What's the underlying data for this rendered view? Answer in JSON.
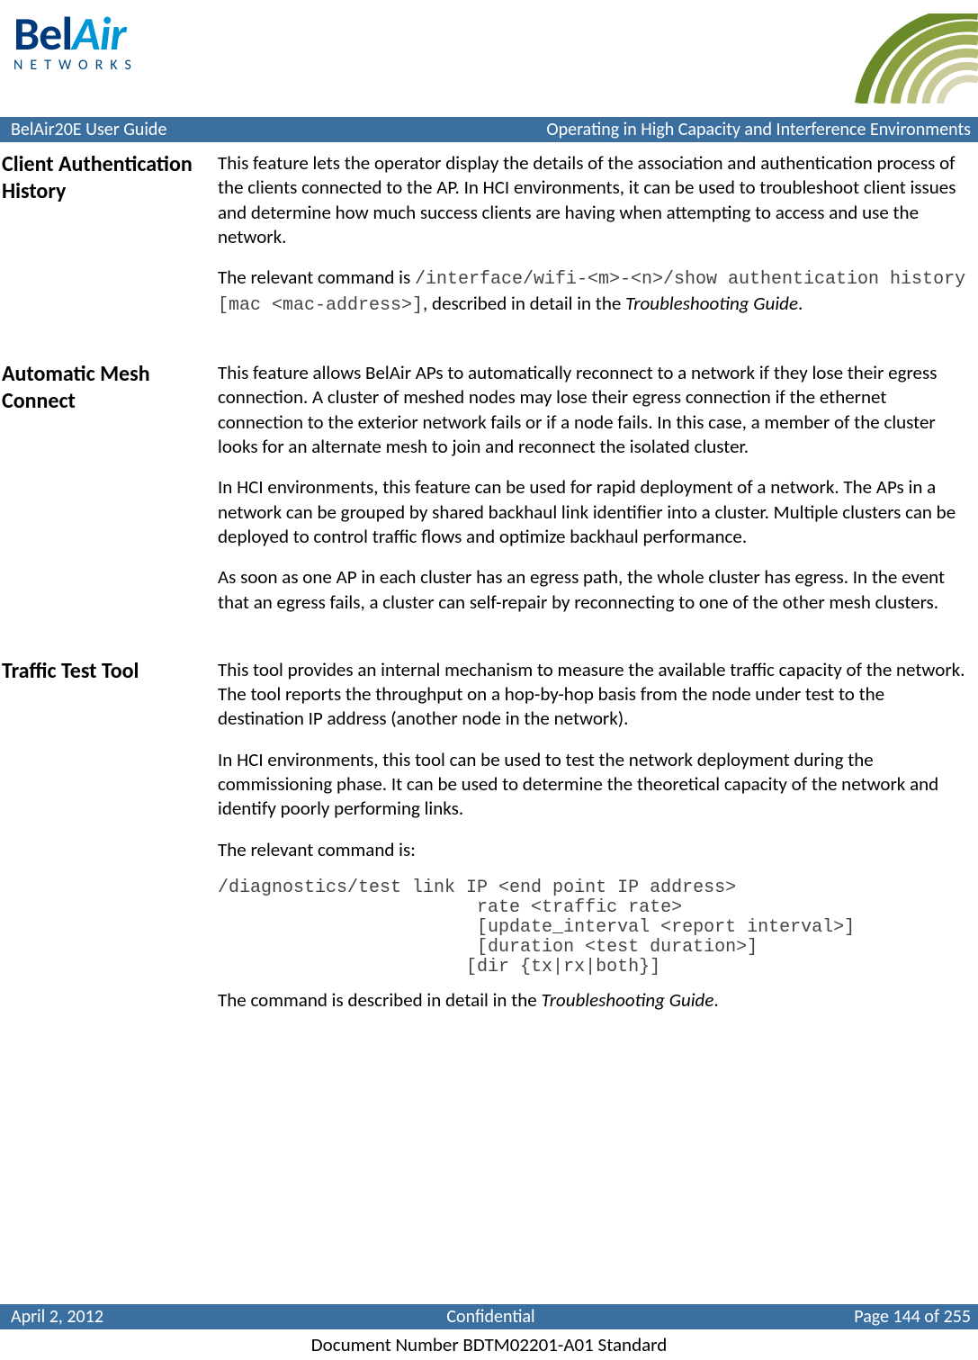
{
  "logo": {
    "line1a": "Bel",
    "line1b": "Air",
    "line2": "NETWORKS"
  },
  "banner": {
    "left": "BelAir20E User Guide",
    "right": "Operating in High Capacity and Interference Environments"
  },
  "sections": [
    {
      "heading": "Client Authentication History",
      "paras": [
        {
          "type": "text",
          "text": "This feature lets the operator display the details of the association and authentication process of the clients connected to the AP. In HCI environments, it can be used to troubleshoot client issues and determine how much success clients are having when attempting to access and use the network."
        },
        {
          "type": "mixed",
          "parts": [
            {
              "t": "The relevant command is "
            },
            {
              "t": "/interface/wifi-<m>-<n>/show authentication history [mac <mac-address>]",
              "code": true
            },
            {
              "t": ", described in detail in the "
            },
            {
              "t": "Troubleshooting Guide",
              "ital": true
            },
            {
              "t": "."
            }
          ]
        }
      ]
    },
    {
      "heading": "Automatic Mesh Connect",
      "paras": [
        {
          "type": "text",
          "text": "This feature allows BelAir APs to automatically reconnect to a network if they lose their egress connection. A cluster of meshed nodes may lose their egress connection if the ethernet connection to the exterior network fails or if a node fails. In this case, a member of the cluster looks for an alternate mesh to join and reconnect the isolated cluster."
        },
        {
          "type": "text",
          "text": "In HCI environments, this feature can be used for rapid deployment of a network. The APs in a network can be grouped by shared backhaul link identifier into a cluster. Multiple clusters can be deployed to control traffic flows and optimize backhaul performance."
        },
        {
          "type": "text",
          "text": "As soon as one AP in each cluster has an egress path, the whole cluster has egress. In the event that an egress fails, a cluster can self-repair by reconnecting to one of the other mesh clusters."
        }
      ]
    },
    {
      "heading": "Traffic Test Tool",
      "paras": [
        {
          "type": "text",
          "text": "This tool provides an internal mechanism to measure the available traffic capacity of the network. The tool reports the throughput on a hop-by-hop basis from the node under test to the destination IP address (another node in the network)."
        },
        {
          "type": "text",
          "text": "In HCI environments, this tool can be used to test the network deployment during the commissioning phase. It can be used to determine the theoretical capacity of the network and identify poorly performing links."
        },
        {
          "type": "text",
          "text": "The relevant command is:"
        },
        {
          "type": "codeblock",
          "text": "/diagnostics/test link IP <end point IP address>\n                        rate <traffic rate>\n                        [update_interval <report interval>]\n                        [duration <test duration>]\n                       [dir {tx|rx|both}]"
        },
        {
          "type": "mixed",
          "parts": [
            {
              "t": "The command is described in detail in the "
            },
            {
              "t": "Troubleshooting Guide",
              "ital": true
            },
            {
              "t": "."
            }
          ]
        }
      ]
    }
  ],
  "footer": {
    "left": "April 2, 2012",
    "center": "Confidential",
    "right": "Page 144 of 255",
    "docnum": "Document Number BDTM02201-A01 Standard"
  }
}
